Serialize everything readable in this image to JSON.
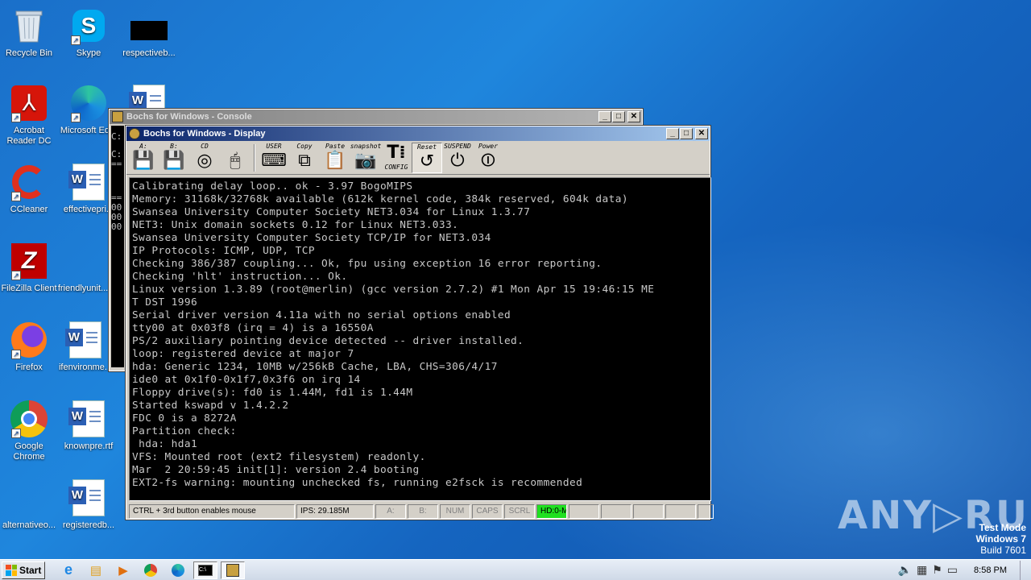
{
  "desktop": {
    "icons": [
      {
        "label": "Recycle Bin"
      },
      {
        "label": "Skype"
      },
      {
        "label": "respectiveb..."
      },
      {
        "label": "Acrobat Reader DC"
      },
      {
        "label": "Microsoft Ed..."
      },
      {
        "label": "CCleaner"
      },
      {
        "label": "effectivepri..."
      },
      {
        "label": "FileZilla Client"
      },
      {
        "label": "friendlyunit..."
      },
      {
        "label": "Firefox"
      },
      {
        "label": "ifenvironme..."
      },
      {
        "label": "Google Chrome"
      },
      {
        "label": "knownpre.rtf"
      },
      {
        "label": "alternativeo..."
      },
      {
        "label": "registeredb..."
      }
    ]
  },
  "console_window": {
    "title": "Bochs for Windows - Console",
    "side_glyphs": [
      "C:",
      "C:",
      "==",
      "==",
      "00",
      "00",
      "00"
    ]
  },
  "display_window": {
    "title": "Bochs for Windows - Display",
    "toolbar": [
      {
        "caption": "A:",
        "icon": "floppy-a-icon"
      },
      {
        "caption": "B:",
        "icon": "floppy-b-icon"
      },
      {
        "caption": "CD",
        "icon": "cdrom-icon"
      },
      {
        "caption": "",
        "icon": "mouse-icon"
      },
      {
        "caption": "USER",
        "icon": "keyboard-icon"
      },
      {
        "caption": "Copy",
        "icon": "copy-icon"
      },
      {
        "caption": "Paste",
        "icon": "paste-icon"
      },
      {
        "caption": "snapshot",
        "icon": "camera-icon"
      },
      {
        "caption": "CONFIG",
        "icon": "config-icon"
      },
      {
        "caption": "Reset",
        "icon": "reset-icon"
      },
      {
        "caption": "SUSPEND",
        "icon": "suspend-icon"
      },
      {
        "caption": "Power",
        "icon": "power-icon"
      }
    ],
    "terminal_lines": [
      "Calibrating delay loop.. ok - 3.97 BogoMIPS",
      "Memory: 31168k/32768k available (612k kernel code, 384k reserved, 604k data)",
      "Swansea University Computer Society NET3.034 for Linux 1.3.77",
      "NET3: Unix domain sockets 0.12 for Linux NET3.033.",
      "Swansea University Computer Society TCP/IP for NET3.034",
      "IP Protocols: ICMP, UDP, TCP",
      "Checking 386/387 coupling... Ok, fpu using exception 16 error reporting.",
      "Checking 'hlt' instruction... Ok.",
      "Linux version 1.3.89 (root@merlin) (gcc version 2.7.2) #1 Mon Apr 15 19:46:15 ME",
      "T DST 1996",
      "Serial driver version 4.11a with no serial options enabled",
      "tty00 at 0x03f8 (irq = 4) is a 16550A",
      "PS/2 auxiliary pointing device detected -- driver installed.",
      "loop: registered device at major 7",
      "hda: Generic 1234, 10MB w/256kB Cache, LBA, CHS=306/4/17",
      "ide0 at 0x1f0-0x1f7,0x3f6 on irq 14",
      "Floppy drive(s): fd0 is 1.44M, fd1 is 1.44M",
      "Started kswapd v 1.4.2.2",
      "FDC 0 is a 8272A",
      "Partition check:",
      " hda: hda1",
      "VFS: Mounted root (ext2 filesystem) readonly.",
      "Mar  2 20:59:45 init[1]: version 2.4 booting",
      "EXT2-fs warning: mounting unchecked fs, running e2fsck is recommended"
    ],
    "status": {
      "mouse_hint": "CTRL + 3rd button enables mouse",
      "ips": "IPS: 29.185M",
      "a": "A:",
      "b": "B:",
      "num": "NUM",
      "caps": "CAPS",
      "scrl": "SCRL",
      "hd": "HD:0-M"
    }
  },
  "watermark": {
    "brand": "ANY▷RUN",
    "test_mode": "Test Mode",
    "os": "Windows 7",
    "build": "Build 7601"
  },
  "taskbar": {
    "start_label": "Start",
    "clock": "8:58 PM"
  },
  "colors": {
    "titlebar_active": "#0a246a",
    "hd_led": "#20e020",
    "terminal_fg": "#c8c8c8"
  }
}
